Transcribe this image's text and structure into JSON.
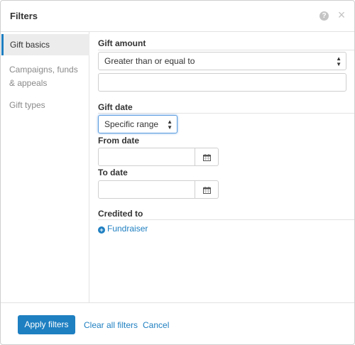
{
  "header": {
    "title": "Filters",
    "help_glyph": "?",
    "close_glyph": "×"
  },
  "sidebar": {
    "items": [
      {
        "label": "Gift basics",
        "active": true
      },
      {
        "label_line1": "Campaigns, funds",
        "label_line2": "& appeals",
        "active": false
      },
      {
        "label": "Gift types",
        "active": false
      }
    ]
  },
  "gift_amount": {
    "title": "Gift amount",
    "operator_value": "Greater than or equal to",
    "amount_value": ""
  },
  "gift_date": {
    "title": "Gift date",
    "range_value": "Specific range",
    "from_label": "From date",
    "from_value": "",
    "to_label": "To date",
    "to_value": ""
  },
  "credited_to": {
    "title": "Credited to",
    "add_link": "Fundraiser"
  },
  "footer": {
    "apply_label": "Apply filters",
    "clear_label": "Clear all filters",
    "cancel_label": "Cancel"
  },
  "colors": {
    "accent": "#1e7fc1",
    "border": "#cfcfcf",
    "muted_text": "#8a8a8a"
  }
}
